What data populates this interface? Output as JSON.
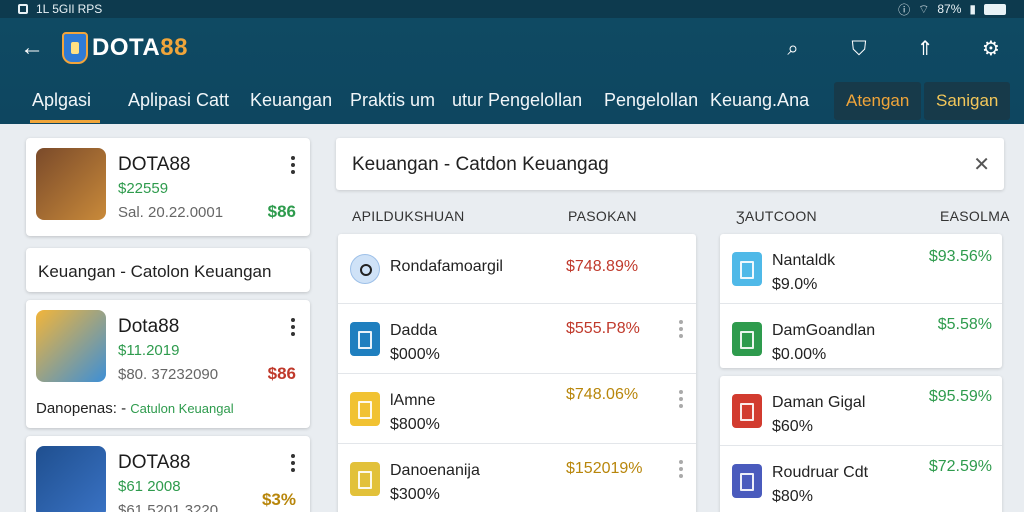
{
  "status_bar": {
    "left_text": "1L 5GIl RPS",
    "right_text": "87%"
  },
  "header": {
    "logo_text_main": "DOTA",
    "logo_text_accent": "88",
    "tabs": [
      "Aplgasi",
      "Aplipasi Catt",
      "Keuangan",
      "Praktis um",
      "utur Pengelollan",
      "Pengelollan",
      "Keuang.Ana"
    ],
    "tab_buttons": [
      "Atengan",
      "Sanigan"
    ]
  },
  "left": {
    "apps": [
      {
        "title": "DOTA88",
        "price": "$22559",
        "sub": "Sal. 20.22.0001",
        "amount": "$86",
        "amount_color": "#2e9b4d"
      },
      {
        "title": "Dota88",
        "price": "$11.2019",
        "sub": "$80. 37232090",
        "amount": "$86",
        "amount_color": "#c0392b"
      },
      {
        "title": "DOTA88",
        "price": "$61 2008",
        "sub": "$61.5201 3220",
        "amount": "$3%",
        "amount_color": "#b8860b"
      }
    ],
    "label1": "Keuangan - Catolon Keuangan",
    "label2_prefix": "Danopenas: -",
    "label2_green": "Catulon Keuangal"
  },
  "main": {
    "title": "Keuangan - Catdon Keuangag",
    "col_heads": [
      "APILDUKSHUAN",
      "PASOKAN",
      "ƷAUTCOON",
      "EASOLMA"
    ],
    "left_rows": [
      {
        "name": "Rondafamoargil",
        "sub": "",
        "amount": "$748.89%",
        "icon": "circle",
        "color": "#cfe2f7"
      },
      {
        "name": "Dadda",
        "sub": "$000%",
        "amount": "$555.P8%",
        "icon": "square",
        "color": "#1f7fbf"
      },
      {
        "name": "lAmne",
        "sub": "$800%",
        "amount": "$748.06%",
        "icon": "square",
        "color": "#f1c232"
      },
      {
        "name": "Danoenanija",
        "sub": "$300%",
        "amount": "$152019%",
        "icon": "square",
        "color": "#e2c13a"
      }
    ],
    "right_rows": [
      {
        "name": "Nantaldk",
        "sub": "$9.0%",
        "amount": "$93.56%",
        "color": "#4fb9e8"
      },
      {
        "name": "DamGoandlan",
        "sub": "$0.00%",
        "amount": "$5.58%",
        "color": "#2e9b4d"
      },
      {
        "name": "Daman Gigal",
        "sub": "$60%",
        "amount": "$95.59%",
        "color": "#d23b2f"
      },
      {
        "name": "Roudruar Cdt",
        "sub": "$80%",
        "amount": "$72.59%",
        "color": "#4a5bbd"
      }
    ],
    "amount_colors": {
      "left": "#c0392b",
      "left_last": "#b8860b",
      "right": "#2e9b4d"
    }
  }
}
